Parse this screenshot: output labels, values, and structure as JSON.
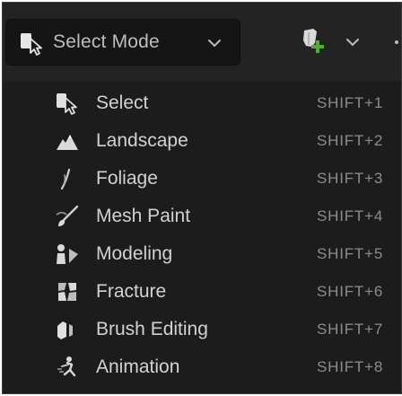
{
  "toolbar": {
    "mode_label": "Select Mode",
    "mode_icon": "select-cursor-icon",
    "add_icon": "add-actor-icon",
    "chevron_icon": "chevron-down-icon"
  },
  "menu": {
    "items": [
      {
        "label": "Select",
        "shortcut": "SHIFT+1",
        "icon": "select-cursor-icon"
      },
      {
        "label": "Landscape",
        "shortcut": "SHIFT+2",
        "icon": "landscape-icon"
      },
      {
        "label": "Foliage",
        "shortcut": "SHIFT+3",
        "icon": "foliage-icon"
      },
      {
        "label": "Mesh Paint",
        "shortcut": "SHIFT+4",
        "icon": "mesh-paint-icon"
      },
      {
        "label": "Modeling",
        "shortcut": "SHIFT+5",
        "icon": "modeling-icon"
      },
      {
        "label": "Fracture",
        "shortcut": "SHIFT+6",
        "icon": "fracture-icon"
      },
      {
        "label": "Brush Editing",
        "shortcut": "SHIFT+7",
        "icon": "brush-editing-icon"
      },
      {
        "label": "Animation",
        "shortcut": "SHIFT+8",
        "icon": "animation-icon"
      }
    ]
  },
  "colors": {
    "background": "#1c1c1c",
    "text": "#d2d2d2",
    "shortcut_text": "#8d8d8d",
    "accent_green": "#4caf2f"
  }
}
